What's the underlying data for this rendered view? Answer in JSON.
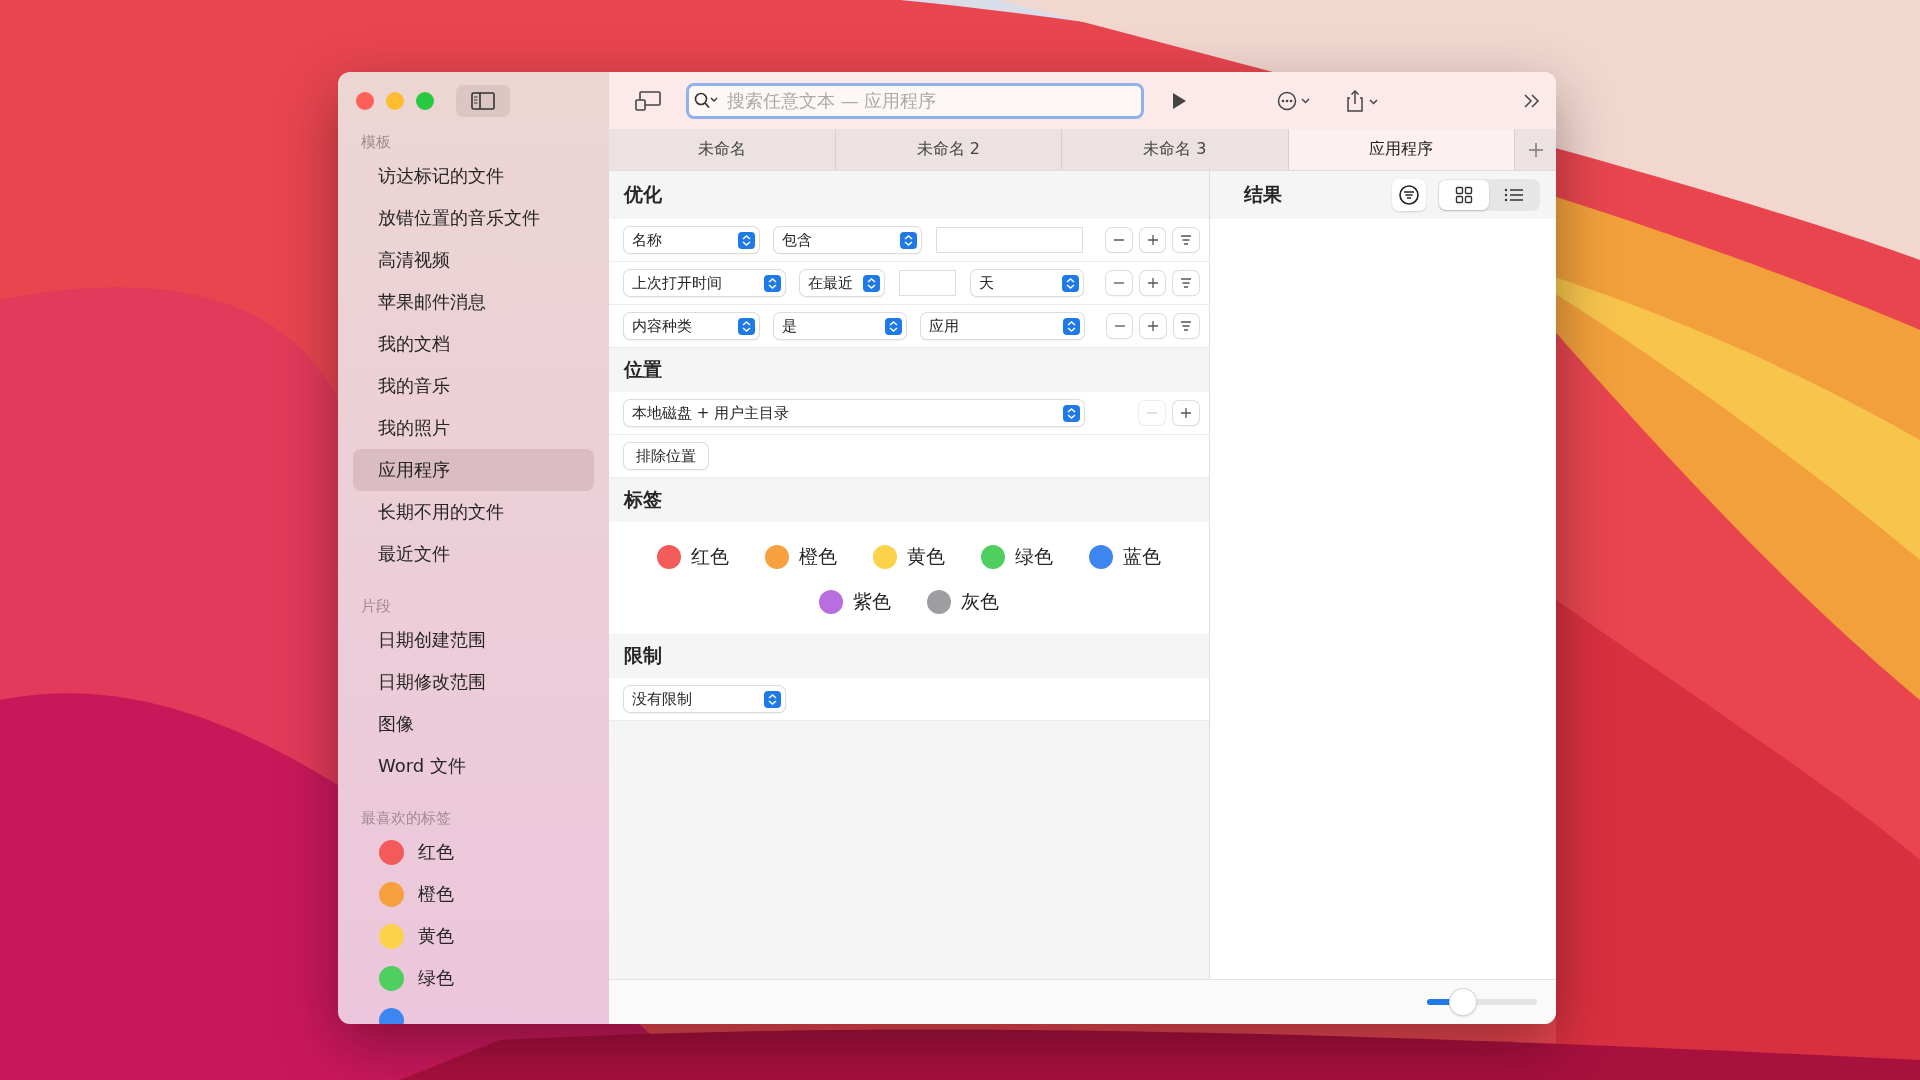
{
  "sidebar": {
    "templates": {
      "title": "模板",
      "items": [
        {
          "label": "访达标记的文件",
          "selected": false
        },
        {
          "label": "放错位置的音乐文件",
          "selected": false
        },
        {
          "label": "高清视频",
          "selected": false
        },
        {
          "label": "苹果邮件消息",
          "selected": false
        },
        {
          "label": "我的文档",
          "selected": false
        },
        {
          "label": "我的音乐",
          "selected": false
        },
        {
          "label": "我的照片",
          "selected": false
        },
        {
          "label": "应用程序",
          "selected": true
        },
        {
          "label": "长期不用的文件",
          "selected": false
        },
        {
          "label": "最近文件",
          "selected": false
        }
      ]
    },
    "snippets": {
      "title": "片段",
      "items": [
        {
          "label": "日期创建范围",
          "selected": false
        },
        {
          "label": "日期修改范围",
          "selected": false
        },
        {
          "label": "图像",
          "selected": false
        },
        {
          "label": "Word 文件",
          "selected": false
        }
      ]
    },
    "favorite_tags": {
      "title": "最喜欢的标签",
      "items": [
        {
          "label": "红色",
          "color": "#f35a5a"
        },
        {
          "label": "橙色",
          "color": "#f6a040"
        },
        {
          "label": "黄色",
          "color": "#fbd24a"
        },
        {
          "label": "绿色",
          "color": "#4fcf5f"
        },
        {
          "color": "#3d86ef"
        }
      ]
    }
  },
  "toolbar": {
    "search": {
      "placeholder": "搜索任意文本 — 应用程序"
    }
  },
  "tabs": [
    {
      "label": "未命名",
      "selected": false
    },
    {
      "label": "未命名 2",
      "selected": false
    },
    {
      "label": "未命名 3",
      "selected": false
    },
    {
      "label": "应用程序",
      "selected": true
    }
  ],
  "criteria": {
    "title": "优化",
    "rows": [
      {
        "controls": [
          {
            "kind": "popup",
            "value": "名称"
          },
          {
            "kind": "popup",
            "value": "包含"
          },
          {
            "kind": "field"
          }
        ]
      },
      {
        "controls": [
          {
            "kind": "popup",
            "value": "上次打开时间"
          },
          {
            "kind": "popup",
            "value": "在最近"
          },
          {
            "kind": "field"
          },
          {
            "kind": "popup",
            "value": "天"
          }
        ]
      },
      {
        "controls": [
          {
            "kind": "popup",
            "value": "内容种类"
          },
          {
            "kind": "popup",
            "value": "是"
          },
          {
            "kind": "popup",
            "value": "应用"
          }
        ]
      }
    ]
  },
  "location": {
    "title": "位置",
    "popup": "本地磁盘 + 用户主目录",
    "remove_disabled": true,
    "exclude_button": "排除位置"
  },
  "tags": {
    "title": "标签",
    "items": [
      {
        "label": "红色",
        "color": "#f35a5a"
      },
      {
        "label": "橙色",
        "color": "#f6a040"
      },
      {
        "label": "黄色",
        "color": "#fbd24a"
      },
      {
        "label": "绿色",
        "color": "#4fcf5f"
      },
      {
        "label": "蓝色",
        "color": "#3d86ef"
      },
      {
        "label": "紫色",
        "color": "#b96ee0"
      },
      {
        "label": "灰色",
        "color": "#9d9da2"
      }
    ]
  },
  "limit": {
    "title": "限制",
    "popup": "没有限制"
  },
  "results": {
    "title": "结果",
    "views": [
      {
        "kind": "grid",
        "selected": true
      },
      {
        "kind": "list",
        "selected": false
      }
    ]
  },
  "zoom_slider": {
    "level": 0.3
  }
}
